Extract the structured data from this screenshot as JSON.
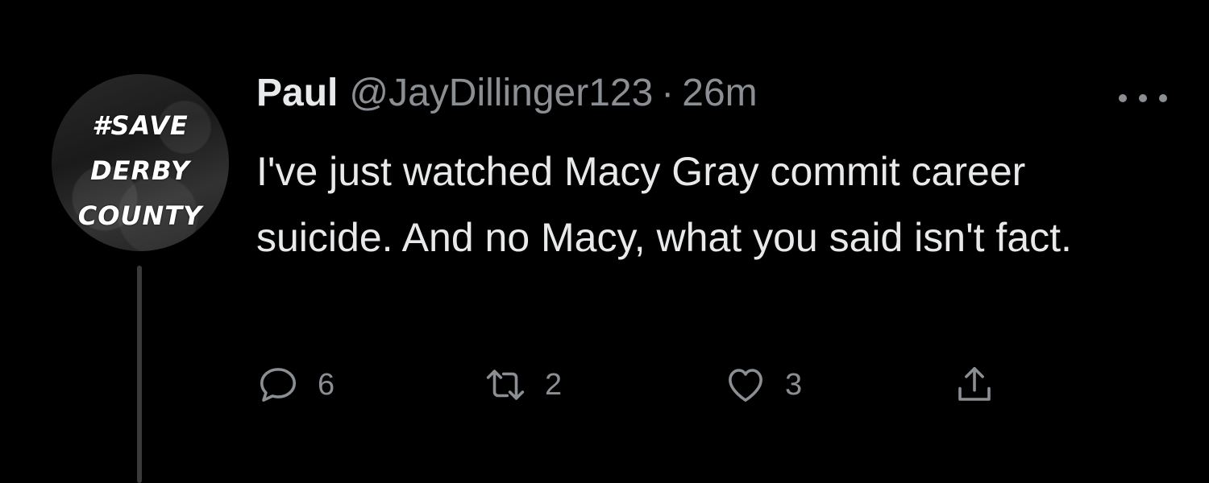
{
  "avatar": {
    "lines": [
      "#SAVE",
      "DERBY",
      "COUNTY"
    ]
  },
  "tweet": {
    "name": "Paul",
    "handle": "@JayDillinger123",
    "separator": "·",
    "time": "26m",
    "text": "I've just watched Macy Gray commit career suicide. And no Macy, what you said isn't fact."
  },
  "actions": {
    "reply": {
      "icon": "reply-icon",
      "count": "6"
    },
    "retweet": {
      "icon": "retweet-icon",
      "count": "2"
    },
    "like": {
      "icon": "heart-icon",
      "count": "3"
    },
    "share": {
      "icon": "share-icon"
    }
  },
  "colors": {
    "background": "#000000",
    "text_primary": "#e7e9ea",
    "text_secondary": "#8b8f93"
  }
}
